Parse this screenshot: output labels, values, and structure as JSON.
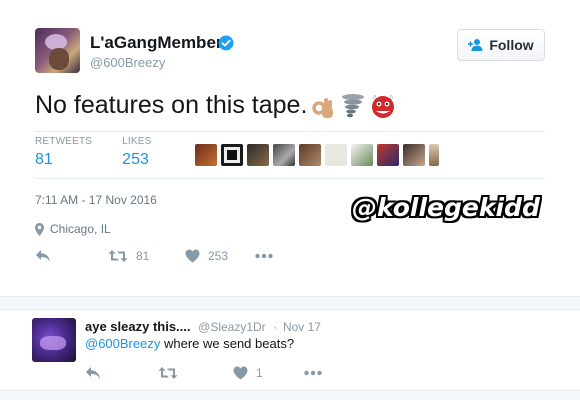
{
  "tweet": {
    "author_name": "L'aGangMember",
    "author_handle": "@600Breezy",
    "follow_label": "Follow",
    "text": "No features on this tape.",
    "emojis": [
      "ok-hand-emoji",
      "tornado-emoji",
      "ogre-emoji"
    ],
    "stats": {
      "retweets_label": "RETWEETS",
      "retweets_value": "81",
      "likes_label": "LIKES",
      "likes_value": "253"
    },
    "timestamp": "7:11 AM - 17 Nov 2016",
    "location": "Chicago, IL",
    "actions": {
      "reply_icon": "reply-icon",
      "retweet_count": "81",
      "like_count": "253",
      "more_icon": "more-icon"
    }
  },
  "watermark": "@kollegekidd",
  "reply": {
    "name": "aye sleazy this....",
    "handle": "@Sleazy1Dr",
    "separator": "·",
    "date": "Nov 17",
    "mention": "@600Breezy",
    "text": " where we send beats?",
    "actions": {
      "like_count": "1"
    }
  },
  "colors": {
    "accent": "#1b95e0",
    "muted": "#8899a6",
    "verified": "#1da1f2"
  }
}
